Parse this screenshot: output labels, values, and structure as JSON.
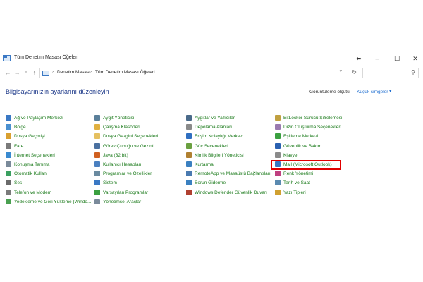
{
  "window": {
    "title": "Tüm Denetim Masası Öğeleri",
    "buttons": [
      "⬌",
      "–",
      "☐",
      "✕"
    ]
  },
  "address_bar": {
    "crumbs": [
      "Denetim Masası",
      "Tüm Denetim Masası Öğeleri"
    ],
    "separator": "›"
  },
  "search": {
    "placeholder": ""
  },
  "header": {
    "title": "Bilgisayarınızın ayarlarını düzenleyin",
    "view_by_label": "Görüntüleme ölçütü:",
    "view_by_value": "Küçük simgeler",
    "view_by_arrow": "▼"
  },
  "colors": {
    "link": "#1a7a1a",
    "heading": "#1e3a8a",
    "highlight": "#e00000",
    "accent": "#1f6fd1"
  },
  "items": [
    {
      "label": "Ağ ve Paylaşım Merkezi",
      "icon": "network-icon",
      "color": "#3a78c4"
    },
    {
      "label": "Aygıt Yöneticisi",
      "icon": "device-manager-icon",
      "color": "#5a7f9a"
    },
    {
      "label": "Aygıtlar ve Yazıcılar",
      "icon": "printer-icon",
      "color": "#4a6a8a"
    },
    {
      "label": "BitLocker Sürücü Şifrelemesi",
      "icon": "bitlocker-icon",
      "color": "#c0a040"
    },
    {
      "label": "Bölge",
      "icon": "region-icon",
      "color": "#4a90d0"
    },
    {
      "label": "Çalışma Klasörleri",
      "icon": "work-folders-icon",
      "color": "#e0b040"
    },
    {
      "label": "Depolama Alanları",
      "icon": "storage-icon",
      "color": "#8a8a8a"
    },
    {
      "label": "Dizin Oluşturma Seçenekleri",
      "icon": "indexing-icon",
      "color": "#9a7ab0"
    },
    {
      "label": "Dosya Geçmişi",
      "icon": "file-history-icon",
      "color": "#d9a030"
    },
    {
      "label": "Dosya Gezgini Seçenekleri",
      "icon": "folder-options-icon",
      "color": "#e5c060"
    },
    {
      "label": "Erişim Kolaylığı Merkezi",
      "icon": "accessibility-icon",
      "color": "#2f6fc0"
    },
    {
      "label": "Eşitleme Merkezi",
      "icon": "sync-icon",
      "color": "#3aa040"
    },
    {
      "label": "Fare",
      "icon": "mouse-icon",
      "color": "#7a7a7a"
    },
    {
      "label": "Görev Çubuğu ve Gezinti",
      "icon": "taskbar-icon",
      "color": "#4a70a0"
    },
    {
      "label": "Güç Seçenekleri",
      "icon": "power-icon",
      "color": "#6aa040"
    },
    {
      "label": "Güvenlik ve Bakım",
      "icon": "security-flag-icon",
      "color": "#2a60b0"
    },
    {
      "label": "İnternet Seçenekleri",
      "icon": "internet-icon",
      "color": "#3a8ad0"
    },
    {
      "label": "Java (32 bit)",
      "icon": "java-icon",
      "color": "#d06020"
    },
    {
      "label": "Kimlik Bilgileri Yöneticisi",
      "icon": "credentials-icon",
      "color": "#b08030"
    },
    {
      "label": "Klavye",
      "icon": "keyboard-icon",
      "color": "#8a8a8a"
    },
    {
      "label": "Konuşma Tanıma",
      "icon": "speech-icon",
      "color": "#7a8a9a"
    },
    {
      "label": "Kullanıcı Hesapları",
      "icon": "user-accounts-icon",
      "color": "#4a80c0"
    },
    {
      "label": "Kurtarma",
      "icon": "recovery-icon",
      "color": "#3a80c0"
    },
    {
      "label": "Mail (Microsoft Outlook)",
      "icon": "mail-icon",
      "color": "#3a78c4"
    },
    {
      "label": "Otomatik Kullan",
      "icon": "autoplay-icon",
      "color": "#3aa060"
    },
    {
      "label": "Programlar ve Özellikler",
      "icon": "programs-icon",
      "color": "#6a8aa0"
    },
    {
      "label": "RemoteApp ve Masaüstü Bağlantıları",
      "icon": "remoteapp-icon",
      "color": "#4a7ab0"
    },
    {
      "label": "Renk Yönetimi",
      "icon": "color-management-icon",
      "color": "#c04080"
    },
    {
      "label": "Ses",
      "icon": "sound-icon",
      "color": "#6a6a6a"
    },
    {
      "label": "Sistem",
      "icon": "system-icon",
      "color": "#3a78c4"
    },
    {
      "label": "Sorun Giderme",
      "icon": "troubleshooting-icon",
      "color": "#3a80c0"
    },
    {
      "label": "Tarih ve Saat",
      "icon": "date-time-icon",
      "color": "#5a8ab0"
    },
    {
      "label": "Telefon ve Modem",
      "icon": "phone-modem-icon",
      "color": "#7a7a7a"
    },
    {
      "label": "Varsayılan Programlar",
      "icon": "default-programs-icon",
      "color": "#3aa040"
    },
    {
      "label": "Windows Defender Güvenlik Duvarı",
      "icon": "firewall-icon",
      "color": "#b04030"
    },
    {
      "label": "Yazı Tipleri",
      "icon": "fonts-icon",
      "color": "#d0a030"
    },
    {
      "label": "Yedekleme ve Geri Yükleme (Windo...",
      "icon": "backup-icon",
      "color": "#4aa050"
    },
    {
      "label": "Yönetimsel Araçlar",
      "icon": "admin-tools-icon",
      "color": "#7a8a9a"
    }
  ]
}
